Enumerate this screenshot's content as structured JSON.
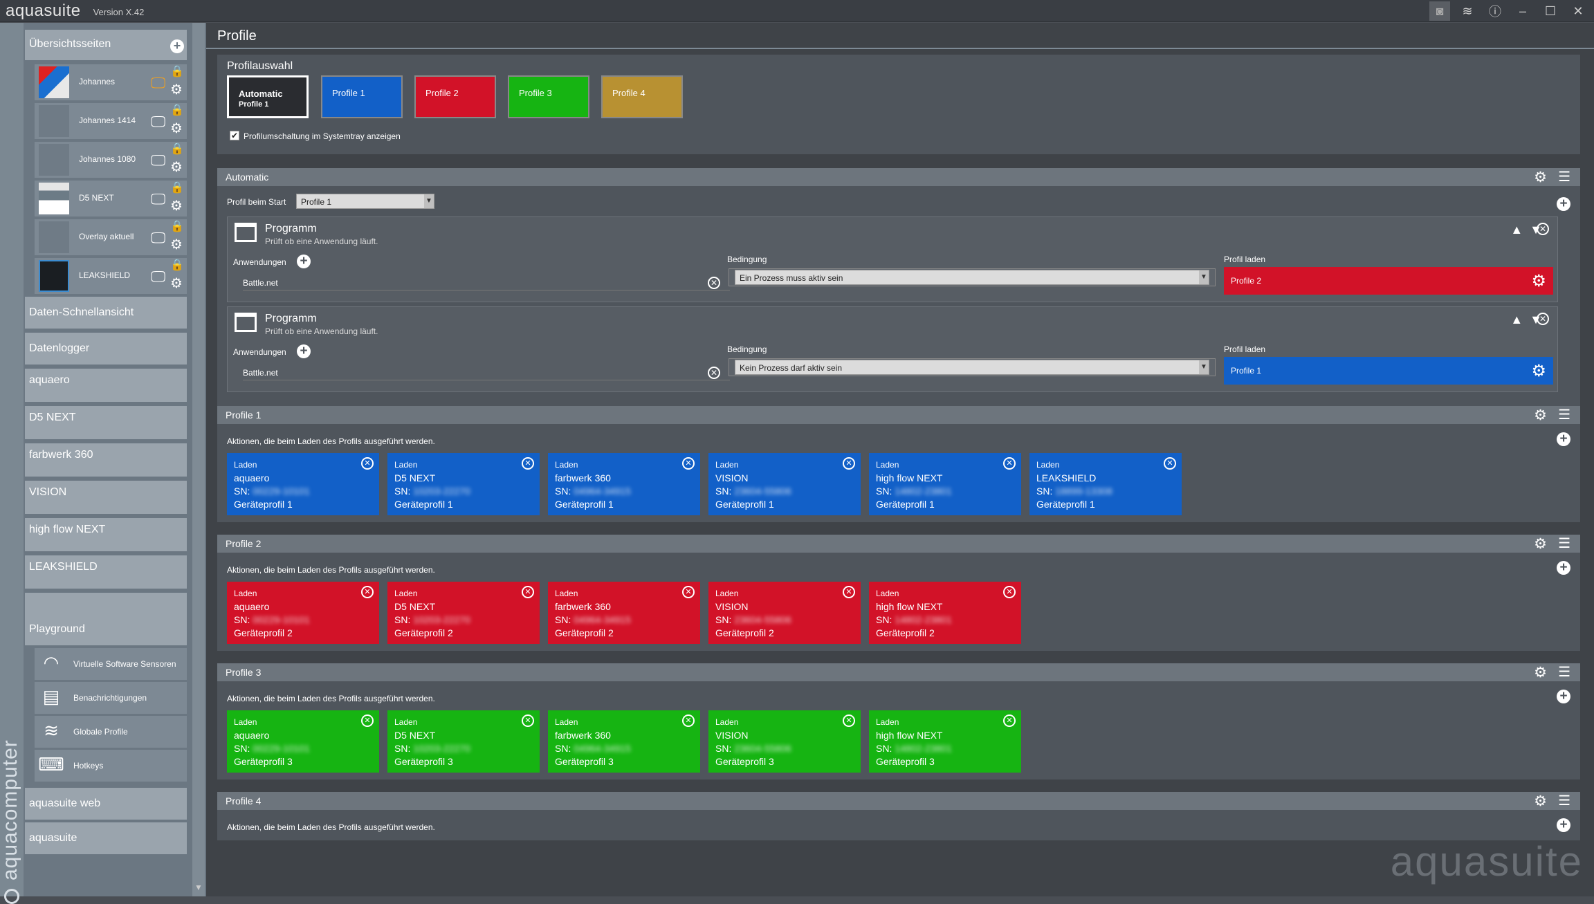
{
  "app": {
    "name": "aquasuite",
    "version": "Version X.42",
    "brand_vertical": "aquacomputer",
    "watermark": "aquasuite"
  },
  "titlebar": {
    "icons": [
      "camera-icon",
      "layers-icon",
      "info-icon",
      "minimize-icon",
      "maximize-icon",
      "close-icon"
    ]
  },
  "sidebar": {
    "overview_header": "Übersichtsseiten",
    "overview_pages": [
      {
        "label": "Johannes"
      },
      {
        "label": "Johannes 1414"
      },
      {
        "label": "Johannes 1080"
      },
      {
        "label": "D5 NEXT"
      },
      {
        "label": "Overlay aktuell"
      },
      {
        "label": "LEAKSHIELD"
      }
    ],
    "items": [
      "Daten-Schnellansicht",
      "Datenlogger",
      "aquaero",
      "D5 NEXT",
      "farbwerk 360",
      "VISION",
      "high flow NEXT",
      "LEAKSHIELD"
    ],
    "playground": "Playground",
    "playground_items": [
      {
        "label": "Virtuelle Software Sensoren",
        "icon": "gauge-icon"
      },
      {
        "label": "Benachrichtigungen",
        "icon": "message-icon"
      },
      {
        "label": "Globale Profile",
        "icon": "layers-icon"
      },
      {
        "label": "Hotkeys",
        "icon": "keyboard-icon"
      }
    ],
    "bottom_items": [
      "aquasuite web",
      "aquasuite"
    ]
  },
  "main": {
    "page_title": "Profile",
    "profilauswahl": {
      "title": "Profilauswahl",
      "buttons": [
        {
          "label": "Automatic",
          "sub": "Profile 1"
        },
        {
          "label": "Profile 1",
          "sub": ""
        },
        {
          "label": "Profile 2",
          "sub": ""
        },
        {
          "label": "Profile 3",
          "sub": ""
        },
        {
          "label": "Profile 4",
          "sub": ""
        }
      ],
      "tray_checkbox": "Profilumschaltung im Systemtray anzeigen",
      "tray_checked": true
    },
    "automatic": {
      "title": "Automatic",
      "start_label": "Profil beim Start",
      "start_value": "Profile 1",
      "rules": [
        {
          "title": "Programm",
          "desc": "Prüft ob eine Anwendung läuft.",
          "apps_label": "Anwendungen",
          "app": "Battle.net",
          "cond_label": "Bedingung",
          "condition": "Ein Prozess muss aktiv sein",
          "load_label": "Profil laden",
          "load_profile": "Profile 2"
        },
        {
          "title": "Programm",
          "desc": "Prüft ob eine Anwendung läuft.",
          "apps_label": "Anwendungen",
          "app": "Battle.net",
          "cond_label": "Bedingung",
          "condition": "Kein Prozess darf aktiv sein",
          "load_label": "Profil laden",
          "load_profile": "Profile 1"
        }
      ]
    },
    "profiles": [
      {
        "title": "Profile 1",
        "desc": "Aktionen, die beim Laden des Profils ausgeführt werden.",
        "actions": [
          {
            "head": "Laden",
            "device": "aquaero",
            "sn": "SN:",
            "sn_val": "00229-10101",
            "profile": "Geräteprofil 1"
          },
          {
            "head": "Laden",
            "device": "D5 NEXT",
            "sn": "SN:",
            "sn_val": "10203-22270",
            "profile": "Geräteprofil 1"
          },
          {
            "head": "Laden",
            "device": "farbwerk 360",
            "sn": "SN:",
            "sn_val": "04964-34915",
            "profile": "Geräteprofil 1"
          },
          {
            "head": "Laden",
            "device": "VISION",
            "sn": "SN:",
            "sn_val": "23604-55806",
            "profile": "Geräteprofil 1"
          },
          {
            "head": "Laden",
            "device": "high flow NEXT",
            "sn": "SN:",
            "sn_val": "14802-23801",
            "profile": "Geräteprofil 1"
          },
          {
            "head": "Laden",
            "device": "LEAKSHIELD",
            "sn": "SN:",
            "sn_val": "18899-13308",
            "profile": "Geräteprofil 1"
          }
        ]
      },
      {
        "title": "Profile 2",
        "desc": "Aktionen, die beim Laden des Profils ausgeführt werden.",
        "actions": [
          {
            "head": "Laden",
            "device": "aquaero",
            "sn": "SN:",
            "sn_val": "00229-10101",
            "profile": "Geräteprofil 2"
          },
          {
            "head": "Laden",
            "device": "D5 NEXT",
            "sn": "SN:",
            "sn_val": "10203-22270",
            "profile": "Geräteprofil 2"
          },
          {
            "head": "Laden",
            "device": "farbwerk 360",
            "sn": "SN:",
            "sn_val": "04964-34915",
            "profile": "Geräteprofil 2"
          },
          {
            "head": "Laden",
            "device": "VISION",
            "sn": "SN:",
            "sn_val": "23604-55806",
            "profile": "Geräteprofil 2"
          },
          {
            "head": "Laden",
            "device": "high flow NEXT",
            "sn": "SN:",
            "sn_val": "14802-23801",
            "profile": "Geräteprofil 2"
          }
        ]
      },
      {
        "title": "Profile 3",
        "desc": "Aktionen, die beim Laden des Profils ausgeführt werden.",
        "actions": [
          {
            "head": "Laden",
            "device": "aquaero",
            "sn": "SN:",
            "sn_val": "00229-10101",
            "profile": "Geräteprofil 3"
          },
          {
            "head": "Laden",
            "device": "D5 NEXT",
            "sn": "SN:",
            "sn_val": "10203-22270",
            "profile": "Geräteprofil 3"
          },
          {
            "head": "Laden",
            "device": "farbwerk 360",
            "sn": "SN:",
            "sn_val": "04964-34915",
            "profile": "Geräteprofil 3"
          },
          {
            "head": "Laden",
            "device": "VISION",
            "sn": "SN:",
            "sn_val": "23604-55806",
            "profile": "Geräteprofil 3"
          },
          {
            "head": "Laden",
            "device": "high flow NEXT",
            "sn": "SN:",
            "sn_val": "14802-23801",
            "profile": "Geräteprofil 3"
          }
        ]
      },
      {
        "title": "Profile 4",
        "desc": "Aktionen, die beim Laden des Profils ausgeführt werden.",
        "actions": []
      }
    ]
  },
  "colors": {
    "profile1": "#1260c8",
    "profile2": "#d21228",
    "profile3": "#16b412",
    "profile4": "#b89132"
  }
}
